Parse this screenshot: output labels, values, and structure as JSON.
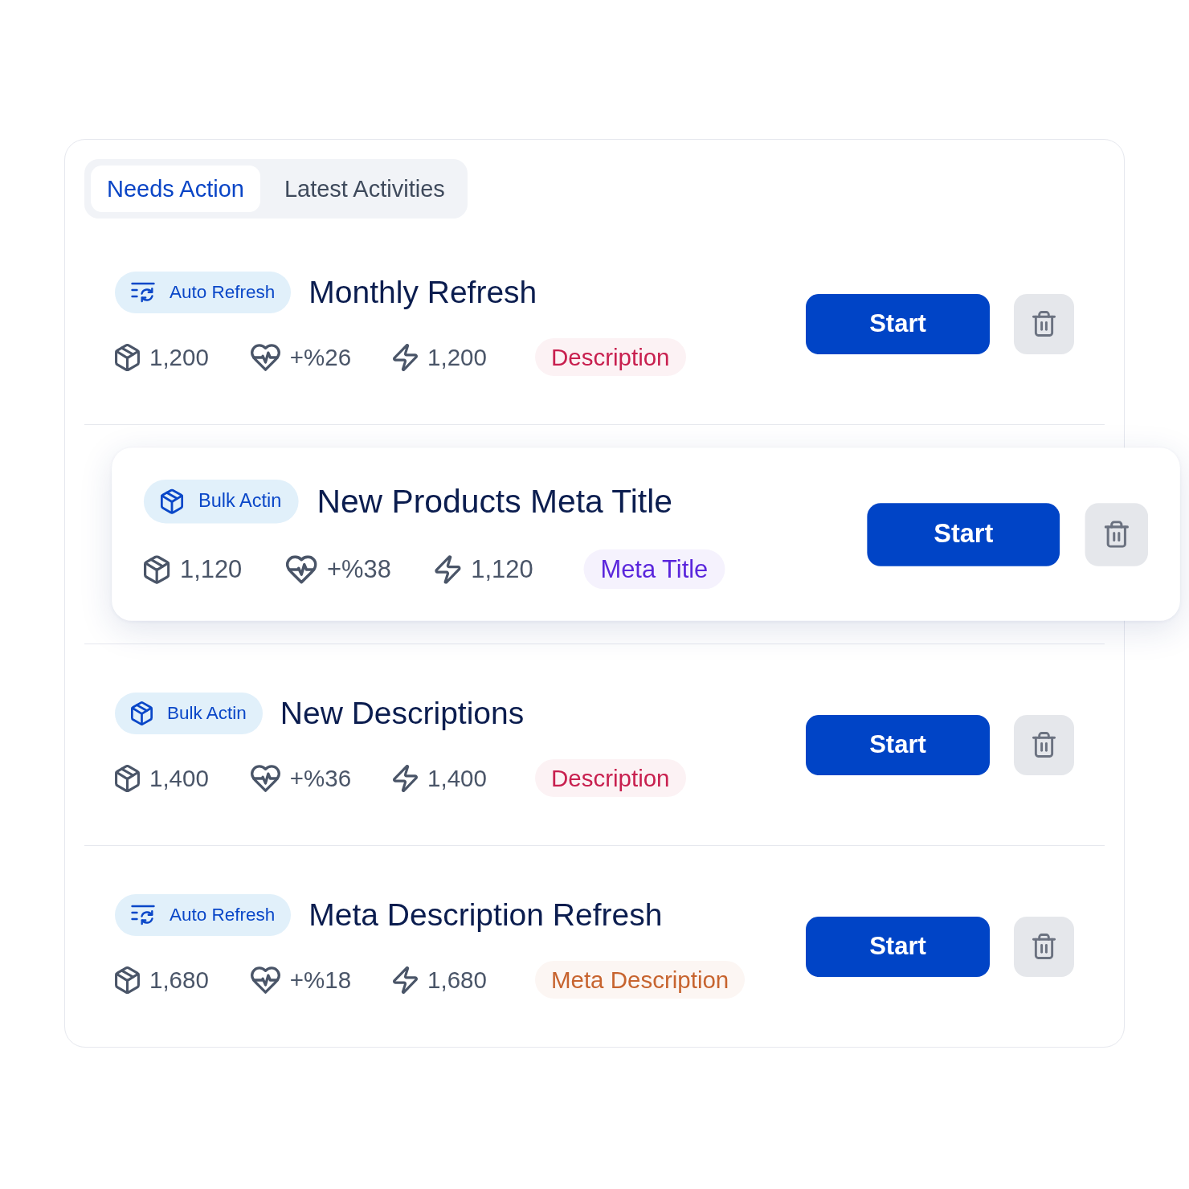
{
  "tabs": [
    {
      "label": "Needs Action",
      "selected": true
    },
    {
      "label": "Latest Activities",
      "selected": false
    }
  ],
  "tasks": [
    {
      "badge": {
        "kind": "refresh",
        "label": "Auto Refresh"
      },
      "title": "Monthly Refresh",
      "highlighted": false,
      "stats": [
        {
          "kind": "box",
          "value": "1,200"
        },
        {
          "kind": "pulse",
          "value": "+%26"
        },
        {
          "kind": "bolt",
          "value": "1,200"
        }
      ],
      "tag": {
        "label": "Description",
        "color": "#c8204f"
      },
      "start_button": "Start"
    },
    {
      "badge": {
        "kind": "bulk",
        "label": "Bulk Actin"
      },
      "title": "New Products Meta Title",
      "highlighted": true,
      "stats": [
        {
          "kind": "box",
          "value": "1,120"
        },
        {
          "kind": "pulse",
          "value": "+%38"
        },
        {
          "kind": "bolt",
          "value": "1,120"
        }
      ],
      "tag": {
        "label": "Meta Title",
        "color": "#5a26dc"
      },
      "start_button": "Start"
    },
    {
      "badge": {
        "kind": "bulk",
        "label": "Bulk Actin"
      },
      "title": "New Descriptions",
      "highlighted": false,
      "stats": [
        {
          "kind": "box",
          "value": "1,400"
        },
        {
          "kind": "pulse",
          "value": "+%36"
        },
        {
          "kind": "bolt",
          "value": "1,400"
        }
      ],
      "tag": {
        "label": "Description",
        "color": "#c8204f"
      },
      "start_button": "Start"
    },
    {
      "badge": {
        "kind": "refresh",
        "label": "Auto Refresh"
      },
      "title": "Meta Description Refresh",
      "highlighted": false,
      "stats": [
        {
          "kind": "box",
          "value": "1,680"
        },
        {
          "kind": "pulse",
          "value": "+%18"
        },
        {
          "kind": "bolt",
          "value": "1,680"
        }
      ],
      "tag": {
        "label": "Meta Description",
        "color": "#c7642f"
      },
      "start_button": "Start"
    }
  ]
}
